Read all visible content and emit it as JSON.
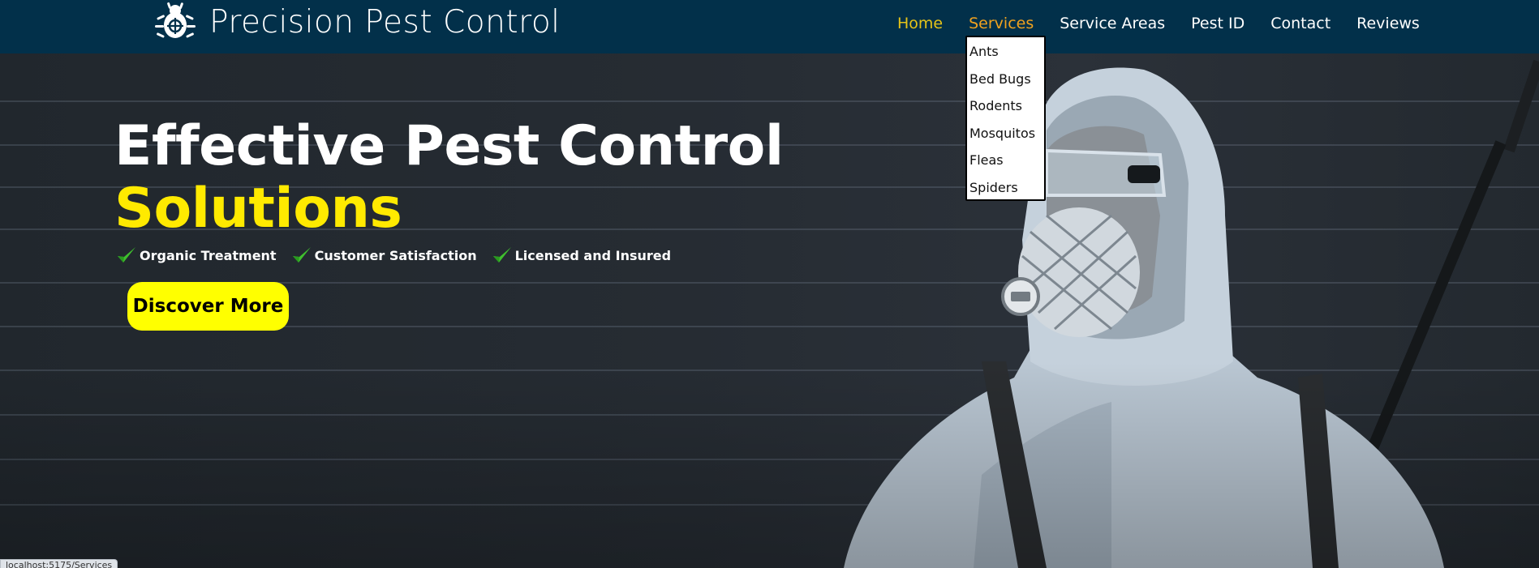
{
  "brand": {
    "name": "Precision Pest Control",
    "logo_icon": "bug-target-icon"
  },
  "nav": {
    "items": [
      {
        "label": "Home"
      },
      {
        "label": "Services"
      },
      {
        "label": "Service Areas"
      },
      {
        "label": "Pest ID"
      },
      {
        "label": "Contact"
      },
      {
        "label": "Reviews"
      }
    ],
    "active": "Home",
    "hovered": "Services"
  },
  "services_dropdown": {
    "items": [
      "Ants",
      "Bed Bugs",
      "Rodents",
      "Mosquitos",
      "Fleas",
      "Spiders"
    ]
  },
  "hero": {
    "title": "Effective Pest Control",
    "subtitle": "Solutions",
    "features": [
      {
        "label": "Organic Treatment",
        "icon": "check-icon"
      },
      {
        "label": "Customer Satisfaction",
        "icon": "check-icon"
      },
      {
        "label": "Licensed and Insured",
        "icon": "check-icon"
      }
    ],
    "cta_label": "Discover More"
  },
  "status_bar": {
    "url": "localhost:5175/Services"
  },
  "colors": {
    "header_bg": "#02304a",
    "nav_active": "#e6c318",
    "nav_hover": "#f0a21f",
    "accent_yellow": "#ffea00",
    "cta_bg": "#ffff00",
    "check_green": "#3fbf2e"
  }
}
